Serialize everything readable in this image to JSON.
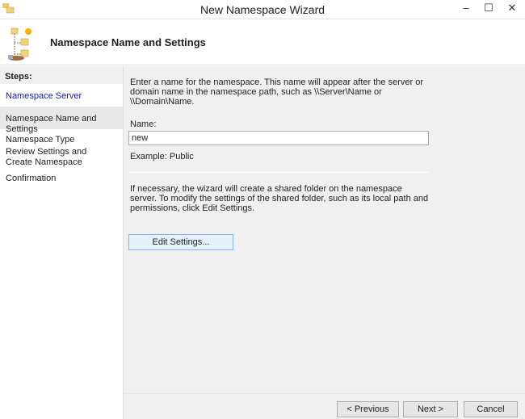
{
  "window": {
    "title": "New Namespace Wizard",
    "minimize": "–",
    "maximize": "☐",
    "close": "✕"
  },
  "header": {
    "title": "Namespace Name and Settings"
  },
  "steps": {
    "heading": "Steps:",
    "items": [
      {
        "label": "Namespace Server"
      },
      {
        "label": "Namespace Name and Settings"
      },
      {
        "label": "Namespace Type"
      },
      {
        "label": "Review Settings and Create Namespace"
      },
      {
        "label": "Confirmation"
      }
    ]
  },
  "content": {
    "intro": "Enter a name for the namespace. This name will appear after the server or domain name in the namespace path, such as \\\\Server\\Name or \\\\Domain\\Name.",
    "name_label": "Name:",
    "name_value": "new",
    "example": "Example: Public",
    "shared_note": "If necessary, the wizard will create a shared folder on the namespace server. To modify the settings of the shared folder, such as its local path and permissions, click Edit Settings.",
    "edit_settings": "Edit Settings..."
  },
  "footer": {
    "previous": "< Previous",
    "next": "Next >",
    "cancel": "Cancel"
  }
}
